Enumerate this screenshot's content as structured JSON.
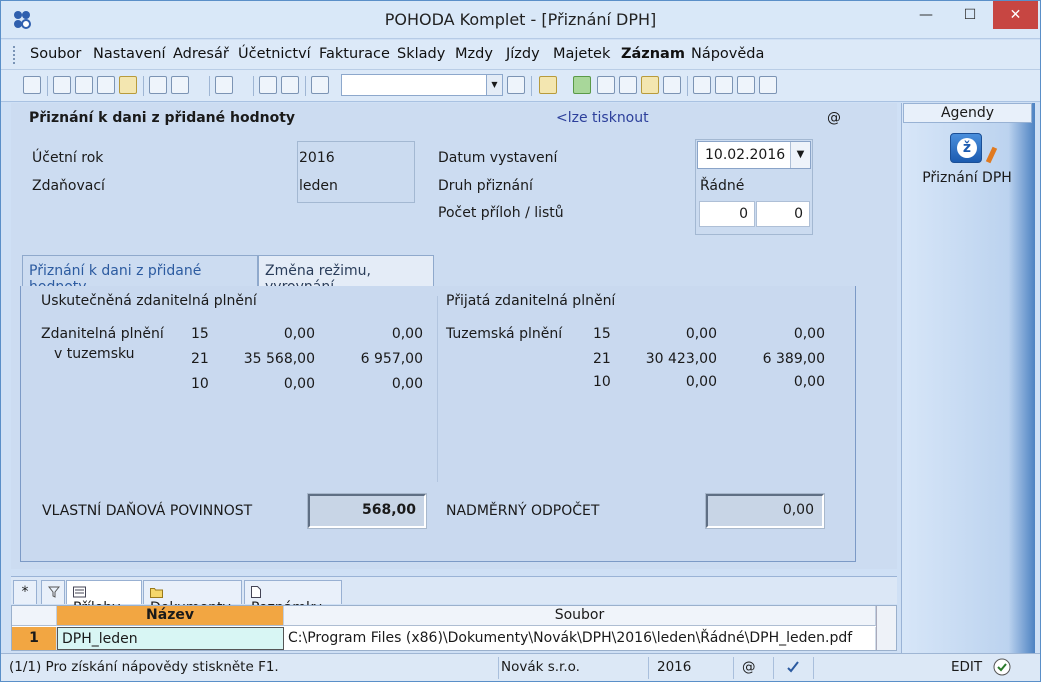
{
  "window": {
    "title": "POHODA Komplet - [Přiznání DPH]",
    "min": "—",
    "max": "☐",
    "close": "✕"
  },
  "menu": [
    "Soubor",
    "Nastavení",
    "Adresář",
    "Účetnictví",
    "Fakturace",
    "Sklady",
    "Mzdy",
    "Jízdy",
    "Majetek",
    "Záznam",
    "Nápověda"
  ],
  "header": {
    "title": "Přiznání k dani z přidané hodnoty",
    "print_link": "<lze tisknout",
    "at": "@"
  },
  "fields": {
    "ucetni_rok_label": "Účetní rok",
    "ucetni_rok_value": "2016",
    "zdanovaci_label": "Zdaňovací",
    "zdanovaci_value": "leden",
    "datum_label": "Datum vystavení",
    "datum_value": "10.02.2016",
    "druh_label": "Druh přiznání",
    "druh_value": "Řádné",
    "pocet_label": "Počet příloh / listů",
    "pocet_prilohy": "0",
    "pocet_listy": "0"
  },
  "tabs": [
    "Přiznání k dani z přidané hodnoty",
    "Změna režimu, vyrovnání"
  ],
  "left": {
    "heading": "Uskutečněná zdanitelná plnění",
    "row_label_1": "Zdanitelná plnění",
    "row_label_2": "v tuzemsku",
    "rows": [
      {
        "rate": "15",
        "base": "0,00",
        "tax": "0,00"
      },
      {
        "rate": "21",
        "base": "35 568,00",
        "tax": "6 957,00"
      },
      {
        "rate": "10",
        "base": "0,00",
        "tax": "0,00"
      }
    ],
    "total_label": "VLASTNÍ DAŇOVÁ POVINNOST",
    "total_value": "568,00"
  },
  "right": {
    "heading": "Přijatá zdanitelná plnění",
    "row_label": "Tuzemská plnění",
    "rows": [
      {
        "rate": "15",
        "base": "0,00",
        "tax": "0,00"
      },
      {
        "rate": "21",
        "base": "30 423,00",
        "tax": "6 389,00"
      },
      {
        "rate": "10",
        "base": "0,00",
        "tax": "0,00"
      }
    ],
    "total_label": "NADMĚRNÝ ODPOČET",
    "total_value": "0,00"
  },
  "lower_tabs": {
    "star": "*",
    "prilohy": "Přílohy",
    "dokumenty": "Dokumenty",
    "poznamky": "Poznámky"
  },
  "grid": {
    "columns": [
      "Název",
      "Soubor"
    ],
    "rows": [
      {
        "num": "1",
        "nazev": "DPH_leden",
        "soubor": "C:\\Program Files (x86)\\Dokumenty\\Novák\\DPH\\2016\\leden\\Řádné\\DPH_leden.pdf"
      }
    ]
  },
  "sidebar": {
    "heading": "Agendy",
    "item": "Přiznání DPH"
  },
  "status": {
    "help": "(1/1) Pro získání nápovědy stiskněte F1.",
    "company": "Novák s.r.o.",
    "year": "2016",
    "at": "@",
    "mode": "EDIT"
  }
}
